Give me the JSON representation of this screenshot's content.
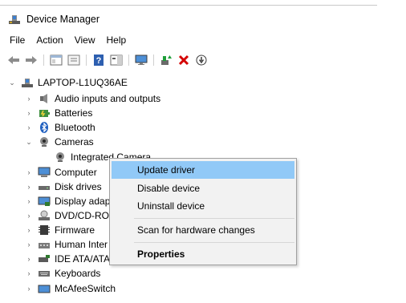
{
  "window": {
    "title": "Device Manager"
  },
  "menubar": {
    "items": [
      "File",
      "Action",
      "View",
      "Help"
    ]
  },
  "toolbar": {
    "buttons": [
      "back-icon",
      "forward-icon",
      "show-hide-console-tree-icon",
      "properties-icon",
      "help-icon",
      "action-pane-icon",
      "monitor-icon",
      "update-driver-icon",
      "uninstall-icon",
      "scan-hardware-icon"
    ]
  },
  "tree": {
    "root": "LAPTOP-L1UQ36AE",
    "items": [
      {
        "label": "Audio inputs and outputs",
        "icon": "speaker-icon",
        "expander": "›"
      },
      {
        "label": "Batteries",
        "icon": "battery-icon",
        "expander": "›"
      },
      {
        "label": "Bluetooth",
        "icon": "bluetooth-icon",
        "expander": "›"
      },
      {
        "label": "Cameras",
        "icon": "camera-icon",
        "expander": "⌄"
      },
      {
        "label": "Integrated Camera",
        "icon": "webcam-icon",
        "expander": ""
      },
      {
        "label": "Computer",
        "icon": "computer-icon",
        "expander": "›"
      },
      {
        "label": "Disk drives",
        "icon": "disk-drive-icon",
        "expander": "›"
      },
      {
        "label": "Display adap",
        "icon": "display-adapter-icon",
        "expander": "›"
      },
      {
        "label": "DVD/CD-RO",
        "icon": "dvd-drive-icon",
        "expander": "›"
      },
      {
        "label": "Firmware",
        "icon": "firmware-icon",
        "expander": "›"
      },
      {
        "label": "Human Inter",
        "icon": "hid-icon",
        "expander": "›"
      },
      {
        "label": "IDE ATA/ATAP",
        "icon": "ide-controller-icon",
        "expander": "›"
      },
      {
        "label": "Keyboards",
        "icon": "keyboard-icon",
        "expander": "›"
      },
      {
        "label": "McAfeeSwitch",
        "icon": "switch-icon",
        "expander": "›"
      }
    ]
  },
  "context_menu": {
    "items": [
      {
        "label": "Update driver",
        "highlighted": true
      },
      {
        "label": "Disable device"
      },
      {
        "label": "Uninstall device"
      },
      {
        "label": "Scan for hardware changes"
      },
      {
        "label": "Properties",
        "bold": true
      }
    ]
  },
  "colors": {
    "highlight": "#91c9f7",
    "menu_bg": "#f2f2f2",
    "uninstall_red": "#d40000",
    "update_green": "#1e9e3a"
  }
}
